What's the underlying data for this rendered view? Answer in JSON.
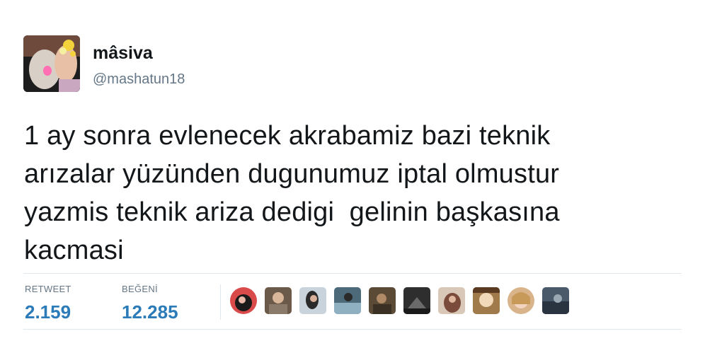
{
  "user": {
    "display_name": "mâsiva",
    "handle": "@mashatun18",
    "avatar_icon": "profile-avatar"
  },
  "tweet": {
    "text": "1 ay sonra evlenecek akrabamiz bazi teknik\narızalar yüzünden dugunumuz iptal olmustur\nyazmis teknik ariza dedigi  gelinin başkasına\nkacmasi"
  },
  "stats": {
    "retweet_label": "RETWEET",
    "retweet_count": "2.159",
    "like_label": "BEĞENİ",
    "like_count": "12.285"
  },
  "likers": [
    {
      "icon": "liker-avatar-1",
      "color": "#c23a3a"
    },
    {
      "icon": "liker-avatar-2",
      "color": "#6b5a4a"
    },
    {
      "icon": "liker-avatar-3",
      "color": "#3a3f48"
    },
    {
      "icon": "liker-avatar-4",
      "color": "#4d6a7a"
    },
    {
      "icon": "liker-avatar-5",
      "color": "#5a4a36"
    },
    {
      "icon": "liker-avatar-6",
      "color": "#2e2e2e"
    },
    {
      "icon": "liker-avatar-7",
      "color": "#7a4a3a"
    },
    {
      "icon": "liker-avatar-8",
      "color": "#a07a4a"
    },
    {
      "icon": "liker-avatar-9",
      "color": "#d9b48a"
    },
    {
      "icon": "liker-avatar-10",
      "color": "#4a5a6a"
    }
  ],
  "colors": {
    "text": "#14171a",
    "muted": "#657786",
    "accent": "#2b7bb9",
    "divider": "#e1e8ed"
  }
}
